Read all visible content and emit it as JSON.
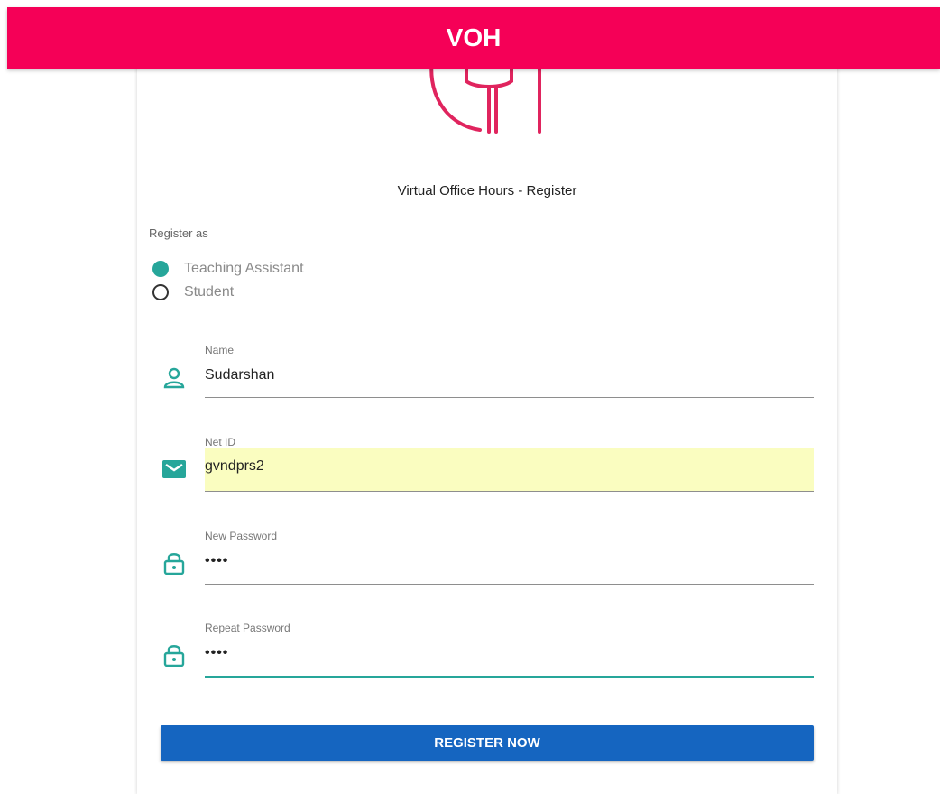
{
  "header": {
    "title": "VOH"
  },
  "subtitle": "Virtual Office Hours - Register",
  "register_as": {
    "label": "Register as",
    "options": [
      {
        "label": "Teaching Assistant",
        "selected": true
      },
      {
        "label": "Student",
        "selected": false
      }
    ]
  },
  "fields": {
    "name": {
      "label": "Name",
      "value": "Sudarshan",
      "icon": "person-icon"
    },
    "net_id": {
      "label": "Net ID",
      "value": "gvndprs2",
      "icon": "email-icon"
    },
    "new_password": {
      "label": "New Password",
      "value": "••••",
      "icon": "lock-icon"
    },
    "repeat_password": {
      "label": "Repeat Password",
      "value": "••••",
      "icon": "lock-icon"
    }
  },
  "register_button": {
    "label": "REGISTER NOW"
  },
  "colors": {
    "appbar": "#f50057",
    "accent": "#26a69a",
    "button": "#1565c0",
    "autofill": "#fafdc0"
  }
}
